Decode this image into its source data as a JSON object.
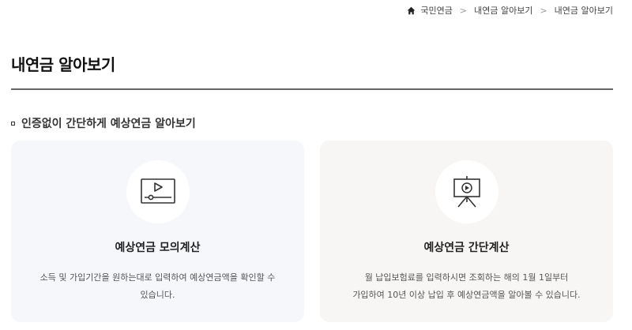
{
  "breadcrumb": {
    "items": [
      "국민연금",
      "내연금 알아보기",
      "내연금 알아보기"
    ],
    "separator": ">"
  },
  "page": {
    "title": "내연금 알아보기"
  },
  "section": {
    "title": "인증없이 간단하게 예상연금 알아보기"
  },
  "cards": [
    {
      "title": "예상연금 모의계산",
      "desc_line1": "소득 및 가입기간을 원하는대로 입력하여 예상연금액을 확인할 수",
      "desc_line2": "있습니다.",
      "icon": "video-player-icon"
    },
    {
      "title": "예상연금 간단계산",
      "desc_line1": "월 납입보험료를 입력하시면 조회하는 해의 1월 1일부터",
      "desc_line2": "가입하여 10년 이상 납입 후 예상연금액을 알아볼 수 있습니다.",
      "icon": "presentation-board-icon"
    }
  ],
  "colors": {
    "card_left_bg": "#f5f7fa",
    "card_right_bg": "#f8f6f4",
    "divider": "#666666"
  }
}
